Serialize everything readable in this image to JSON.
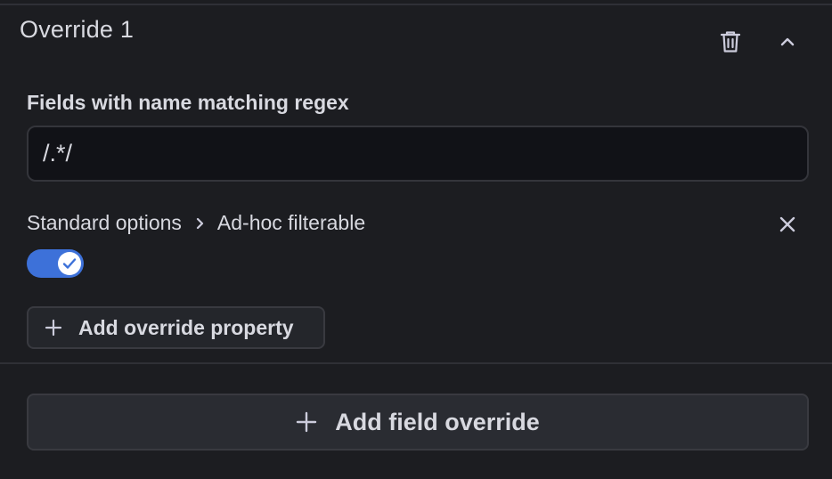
{
  "override": {
    "title": "Override 1",
    "delete_icon": "trash-icon",
    "collapse_icon": "chevron-up-icon"
  },
  "matcher": {
    "label": "Fields with name matching regex",
    "value": "/.*/"
  },
  "property": {
    "category": "Standard options",
    "separator_icon": "chevron-right-icon",
    "name": "Ad-hoc filterable",
    "remove_icon": "close-icon",
    "toggle_on": true
  },
  "add_property": {
    "icon": "plus-icon",
    "label": "Add override property"
  },
  "add_field_override": {
    "icon": "plus-icon",
    "label": "Add field override"
  },
  "colors": {
    "background": "#1c1d21",
    "toggle_accent": "#3d71d9",
    "input_background": "#111217"
  }
}
